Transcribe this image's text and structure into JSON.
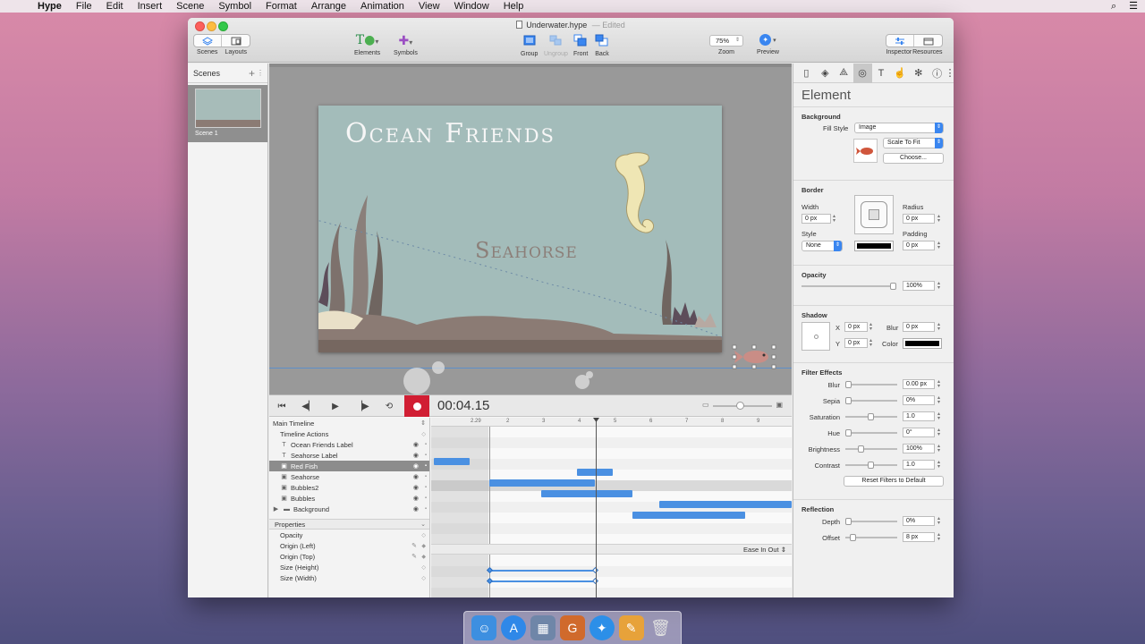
{
  "menubar": {
    "app": "Hype",
    "items": [
      "File",
      "Edit",
      "Insert",
      "Scene",
      "Symbol",
      "Format",
      "Arrange",
      "Animation",
      "View",
      "Window",
      "Help"
    ]
  },
  "window": {
    "title": "Underwater.hype",
    "status": "Edited"
  },
  "toolbar": {
    "scenes_label": "Scenes",
    "layouts_label": "Layouts",
    "elements_label": "Elements",
    "symbols_label": "Symbols",
    "group_label": "Group",
    "ungroup_label": "Ungroup",
    "front_label": "Front",
    "back_label": "Back",
    "zoom_value": "75%",
    "zoom_label": "Zoom",
    "preview_label": "Preview",
    "inspector_label": "Inspector",
    "resources_label": "Resources"
  },
  "scenes_panel": {
    "title": "Scenes",
    "scenes": [
      {
        "label": "Scene 1"
      }
    ]
  },
  "stage": {
    "title_text": "Ocean Friends",
    "seahorse_text": "Seahorse"
  },
  "timeline": {
    "time": "00:04.15",
    "ruler": [
      "2.29",
      "2",
      "3",
      "4",
      "5",
      "6",
      "7",
      "8",
      "9"
    ],
    "rows": [
      {
        "label": "Main Timeline"
      },
      {
        "label": "Timeline Actions"
      },
      {
        "label": "Ocean Friends Label"
      },
      {
        "label": "Seahorse Label"
      },
      {
        "label": "Red Fish"
      },
      {
        "label": "Seahorse"
      },
      {
        "label": "Bubbles2"
      },
      {
        "label": "Bubbles"
      },
      {
        "label": "Background"
      }
    ],
    "properties_title": "Properties",
    "easing": "Ease In Out",
    "properties": [
      {
        "label": "Opacity"
      },
      {
        "label": "Origin (Left)"
      },
      {
        "label": "Origin (Top)"
      },
      {
        "label": "Size (Height)"
      },
      {
        "label": "Size (Width)"
      }
    ]
  },
  "inspector": {
    "title": "Element",
    "background": {
      "title": "Background",
      "fill_style_label": "Fill Style",
      "fill_style_value": "Image",
      "scale_value": "Scale To Fit",
      "choose_label": "Choose..."
    },
    "border": {
      "title": "Border",
      "width_label": "Width",
      "width_value": "0 px",
      "radius_label": "Radius",
      "radius_value": "0 px",
      "style_label": "Style",
      "style_value": "None",
      "padding_label": "Padding",
      "padding_value": "0 px"
    },
    "opacity": {
      "title": "Opacity",
      "value": "100%"
    },
    "shadow": {
      "title": "Shadow",
      "x_label": "X",
      "x_value": "0 px",
      "y_label": "Y",
      "y_value": "0 px",
      "blur_label": "Blur",
      "blur_value": "0 px",
      "color_label": "Color"
    },
    "filters": {
      "title": "Filter Effects",
      "items": [
        {
          "label": "Blur",
          "value": "0.00 px"
        },
        {
          "label": "Sepia",
          "value": "0%"
        },
        {
          "label": "Saturation",
          "value": "1.0"
        },
        {
          "label": "Hue",
          "value": "0°"
        },
        {
          "label": "Brightness",
          "value": "100%"
        },
        {
          "label": "Contrast",
          "value": "1.0"
        }
      ],
      "reset_label": "Reset Filters to Default"
    },
    "reflection": {
      "title": "Reflection",
      "depth_label": "Depth",
      "depth_value": "0%",
      "offset_label": "Offset",
      "offset_value": "8 px"
    }
  },
  "colors": {
    "accent": "#4a90e2",
    "record": "#d11e33",
    "stage_water": "#a3bcba"
  }
}
